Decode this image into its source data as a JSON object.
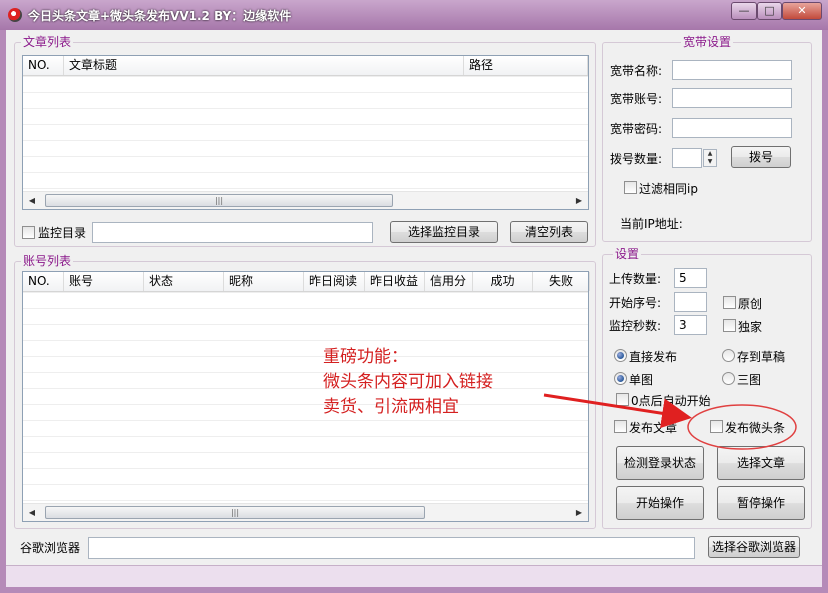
{
  "window": {
    "title": "今日头条文章+微头条发布VV1.2 BY：边缘软件",
    "minimize_glyph": "—",
    "maximize_glyph": "□",
    "close_glyph": "✕"
  },
  "articles": {
    "group_title": "文章列表",
    "columns": [
      "NO.",
      "文章标题",
      "路径"
    ],
    "rows": []
  },
  "monitor": {
    "checkbox_label": "监控目录",
    "checked": false,
    "path_value": "",
    "choose_button": "选择监控目录",
    "clear_button": "清空列表"
  },
  "accounts": {
    "group_title": "账号列表",
    "columns": [
      "NO.",
      "账号",
      "状态",
      "昵称",
      "昨日阅读",
      "昨日收益",
      "信用分",
      "成功",
      "失败"
    ],
    "rows": []
  },
  "broadband": {
    "group_title": "宽带设置",
    "name_label": "宽带名称:",
    "name_value": "",
    "account_label": "宽带账号:",
    "account_value": "",
    "password_label": "宽带密码:",
    "password_value": "",
    "dial_count_label": "拨号数量:",
    "dial_count_value": "",
    "dial_button": "拨号",
    "filter_ip_label": "过滤相同ip",
    "filter_ip_checked": false,
    "current_ip_label": "当前IP地址:",
    "current_ip_value": ""
  },
  "settings": {
    "group_title": "设置",
    "upload_count_label": "上传数量:",
    "upload_count_value": "5",
    "start_seq_label": "开始序号:",
    "start_seq_value": "",
    "original_label": "原创",
    "original_checked": false,
    "monitor_seconds_label": "监控秒数:",
    "monitor_seconds_value": "3",
    "exclusive_label": "独家",
    "exclusive_checked": false,
    "publish_direct_label": "直接发布",
    "publish_direct_selected": true,
    "save_draft_label": "存到草稿",
    "single_image_label": "单图",
    "single_image_selected": true,
    "three_image_label": "三图",
    "auto_start_label": "0点后自动开始",
    "auto_start_checked": false,
    "publish_article_label": "发布文章",
    "publish_article_checked": false,
    "publish_weitoutiao_label": "发布微头条",
    "publish_weitoutiao_checked": false,
    "check_login_button": "检测登录状态",
    "select_article_button": "选择文章",
    "start_button": "开始操作",
    "pause_button": "暂停操作"
  },
  "browser": {
    "label": "谷歌浏览器",
    "path_value": "",
    "choose_button": "选择谷歌浏览器"
  },
  "annotation": {
    "line1": "重磅功能：",
    "line2": "微头条内容可加入链接",
    "line3": "卖货、引流两相宜"
  },
  "colors": {
    "title_bar": "#a677aa",
    "group_title": "#8b1a8b",
    "annotation": "#d42020"
  },
  "icons": {
    "app": "app-logo-icon",
    "scroll_left": "◀",
    "scroll_right": "▶",
    "thumb_grip": "|||",
    "spin_up": "▲",
    "spin_down": "▼"
  }
}
